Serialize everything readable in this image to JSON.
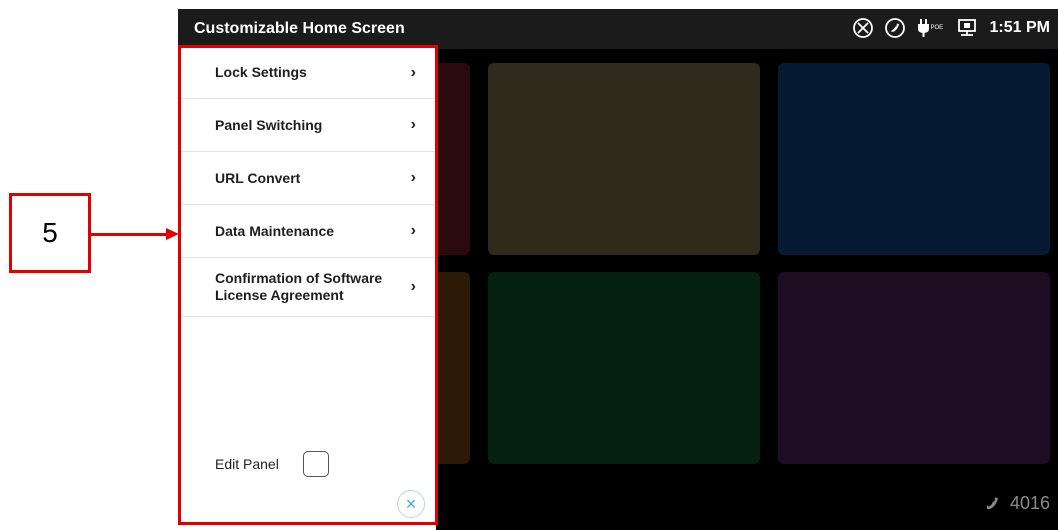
{
  "callout": {
    "number": "5"
  },
  "status_bar": {
    "title": "Customizable Home Screen",
    "time": "1:51 PM",
    "icons": [
      "network-disconnected-icon",
      "phone-icon",
      "poe-plug-icon",
      "lan-icon"
    ],
    "poe_label": "POE"
  },
  "drawer": {
    "items": [
      {
        "label": "Lock Settings",
        "chevron": "›"
      },
      {
        "label": "Panel Switching",
        "chevron": "›"
      },
      {
        "label": "URL Convert",
        "chevron": "›"
      },
      {
        "label": "Data Maintenance",
        "chevron": "›"
      },
      {
        "label": "Confirmation of Software License Agreement",
        "chevron": "›"
      }
    ],
    "edit_panel_label": "Edit Panel",
    "edit_panel_checked": false,
    "close_glyph": "×"
  },
  "home": {
    "extension": "4016",
    "tile_colors": [
      "#2a0a0e",
      "#2e2a1c",
      "#061a33",
      "#2c1a06",
      "#072110",
      "#1e0c22"
    ]
  },
  "colors": {
    "highlight": "#e00000",
    "close_accent": "#4aa3df"
  }
}
